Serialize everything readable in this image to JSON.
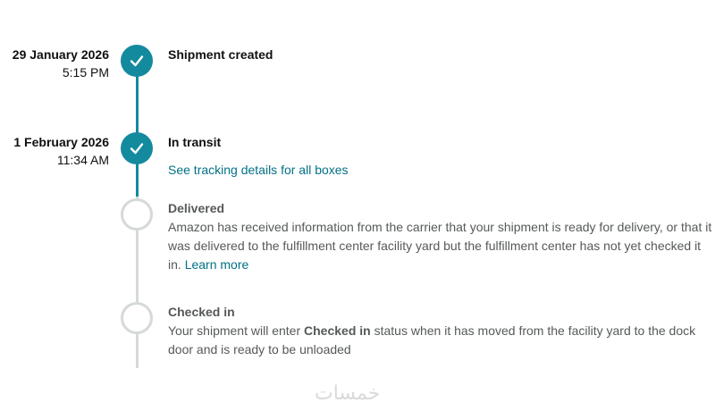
{
  "steps": [
    {
      "date": "29 January 2026",
      "time": "5:15 PM",
      "title": "Shipment created",
      "status": "done"
    },
    {
      "date": "1 February 2026",
      "time": "11:34 AM",
      "title": "In transit",
      "status": "done",
      "link": "See tracking details for all boxes"
    },
    {
      "title": "Delivered",
      "status": "pending",
      "description": "Amazon has received information from the carrier that your shipment is ready for delivery, or that it was delivered to the fulfillment center facility yard but the fulfillment center has not yet checked it in.",
      "link": "Learn more"
    },
    {
      "title": "Checked in",
      "status": "pending",
      "description_prefix": "Your shipment will enter",
      "description_strong": "Checked in",
      "description_suffix": "status when it has moved from the facility yard to the dock door and is ready to be unloaded"
    }
  ],
  "watermark": "خمسات",
  "colors": {
    "accent": "#138a9e",
    "link": "#007185",
    "pending": "#d5d9d9"
  },
  "icons": {
    "done": "checkmark-icon",
    "pending": "empty-circle-icon"
  }
}
